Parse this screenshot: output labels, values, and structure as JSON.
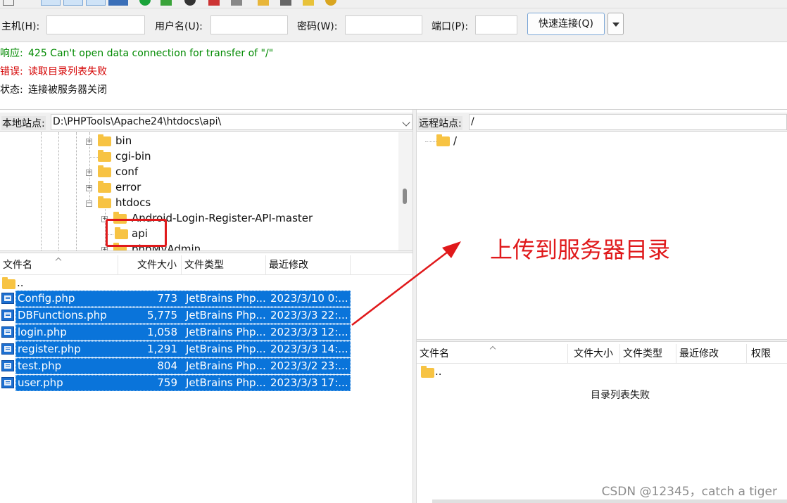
{
  "quickconnect": {
    "host_label": "主机(H):",
    "host_value": "",
    "user_label": "用户名(U):",
    "user_value": "",
    "password_label": "密码(W):",
    "password_value": "",
    "port_label": "端口(P):",
    "port_value": "",
    "connect_button": "快速连接(Q)"
  },
  "log": [
    {
      "tag": "响应:",
      "text": "425 Can't open data connection for transfer of \"/\"",
      "color": "#008a00"
    },
    {
      "tag": "错误:",
      "text": "读取目录列表失败",
      "color": "#d40000"
    },
    {
      "tag": "状态:",
      "text": "连接被服务器关闭",
      "color": "#111111"
    }
  ],
  "local": {
    "site_label": "本地站点:",
    "path": "D:\\PHPTools\\Apache24\\htdocs\\api\\",
    "tree": [
      {
        "name": "bin",
        "expandable": true
      },
      {
        "name": "cgi-bin",
        "expandable": false
      },
      {
        "name": "conf",
        "expandable": true
      },
      {
        "name": "error",
        "expandable": true
      },
      {
        "name": "htdocs",
        "expandable": true
      },
      {
        "name": "Android-Login-Register-API-master",
        "expandable": true
      },
      {
        "name": "api",
        "expandable": false
      },
      {
        "name": "phpMyAdmin",
        "expandable": true
      }
    ],
    "columns": [
      "文件名",
      "文件大小",
      "文件类型",
      "最近修改"
    ],
    "parent_entry": "..",
    "files": [
      {
        "name": "Config.php",
        "size": "773",
        "type": "JetBrains Php...",
        "modified": "2023/3/10 0:..."
      },
      {
        "name": "DBFunctions.php",
        "size": "5,775",
        "type": "JetBrains Php...",
        "modified": "2023/3/3 22:..."
      },
      {
        "name": "login.php",
        "size": "1,058",
        "type": "JetBrains Php...",
        "modified": "2023/3/3 12:..."
      },
      {
        "name": "register.php",
        "size": "1,291",
        "type": "JetBrains Php...",
        "modified": "2023/3/3 14:..."
      },
      {
        "name": "test.php",
        "size": "804",
        "type": "JetBrains Php...",
        "modified": "2023/3/2 23:..."
      },
      {
        "name": "user.php",
        "size": "759",
        "type": "JetBrains Php...",
        "modified": "2023/3/3 17:..."
      }
    ]
  },
  "remote": {
    "site_label": "远程站点:",
    "path": "/",
    "tree_root": "/",
    "columns": [
      "文件名",
      "文件大小",
      "文件类型",
      "最近修改",
      "权限"
    ],
    "parent_entry": "..",
    "status_message": "目录列表失败"
  },
  "annotation": "上传到服务器目录",
  "watermark": "CSDN @12345，catch a tiger",
  "colors": {
    "selection": "#0a74da",
    "annotation_red": "#e0191b",
    "response_green": "#008a00",
    "error_red": "#d40000"
  }
}
